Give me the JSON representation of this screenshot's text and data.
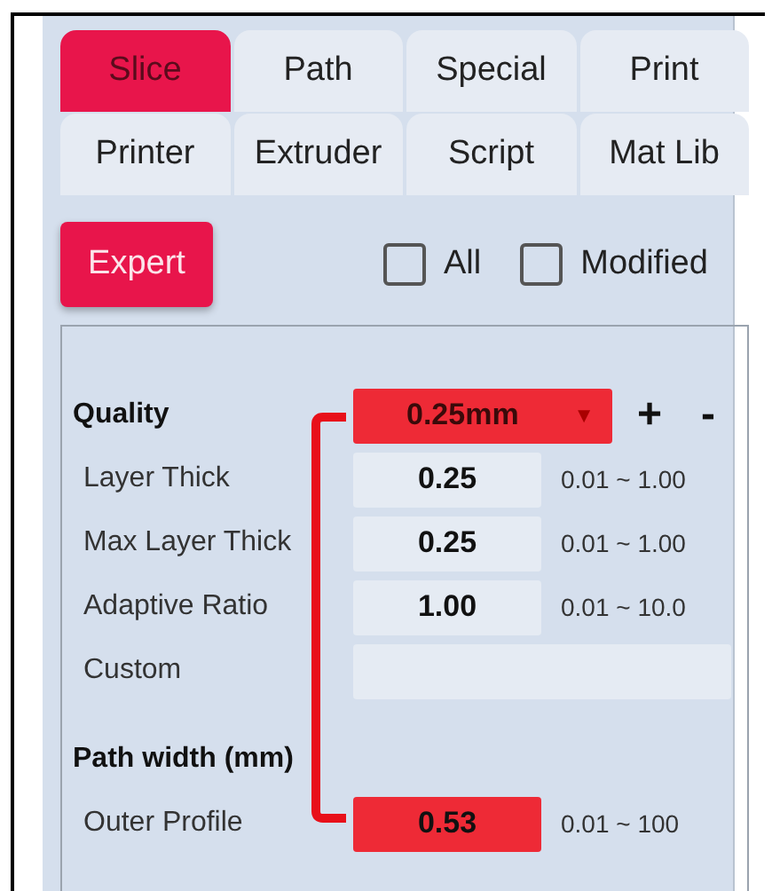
{
  "tabs": [
    {
      "label": "Slice",
      "selected": true
    },
    {
      "label": "Path",
      "selected": false
    },
    {
      "label": "Special",
      "selected": false
    },
    {
      "label": "Print",
      "selected": false
    },
    {
      "label": "Printer",
      "selected": false
    },
    {
      "label": "Extruder",
      "selected": false
    },
    {
      "label": "Script",
      "selected": false
    },
    {
      "label": "Mat Lib",
      "selected": false
    }
  ],
  "mode_button": {
    "label": "Expert"
  },
  "filters": [
    {
      "label": "All",
      "checked": false
    },
    {
      "label": "Modified",
      "checked": false
    }
  ],
  "quality": {
    "label": "Quality",
    "value": "0.25mm",
    "arrow": "▼",
    "add": "+",
    "remove": "-"
  },
  "quality_rows": [
    {
      "label": "Layer Thick",
      "value": "0.25",
      "range": "0.01 ~ 1.00",
      "highlighted": false
    },
    {
      "label": "Max Layer Thick",
      "value": "0.25",
      "range": "0.01 ~ 1.00",
      "highlighted": false
    },
    {
      "label": "Adaptive Ratio",
      "value": "1.00",
      "range": "0.01 ~ 10.0",
      "highlighted": false
    },
    {
      "label": "Custom",
      "highlighted": false,
      "wide": true
    }
  ],
  "path_width": {
    "label": "Path width (mm)"
  },
  "path_rows": [
    {
      "label": "Outer Profile",
      "value": "0.53",
      "range": "0.01 ~ 100",
      "highlighted": true
    }
  ]
}
